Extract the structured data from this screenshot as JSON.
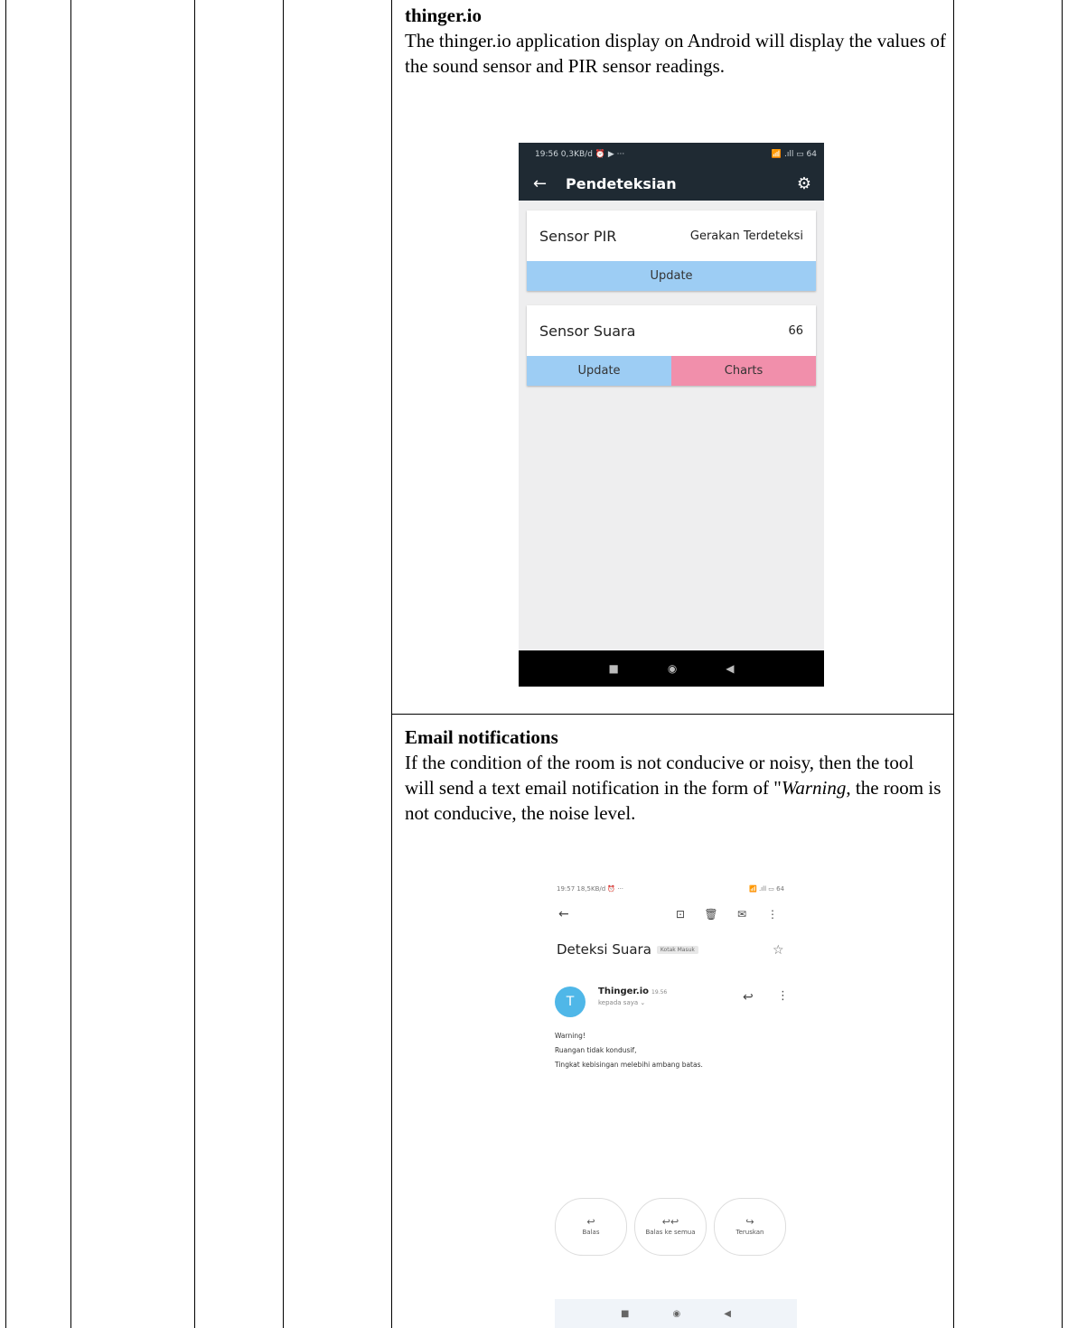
{
  "section1": {
    "heading": "thinger.io",
    "body": "The thinger.io application display on Android will display the values of the sound sensor and PIR sensor readings."
  },
  "phone1": {
    "status_left": "19:56 0,3KB/d ⏰ ▶ ···",
    "status_right": "📶 .ıll ▭ 64",
    "back_icon": "←",
    "title": "Pendeteksian",
    "gear_icon": "⚙",
    "pir_card": {
      "name": "Sensor PIR",
      "value": "Gerakan Terdeteksi",
      "update_label": "Update"
    },
    "sound_card": {
      "name": "Sensor Suara",
      "value": "66",
      "update_label": "Update",
      "charts_label": "Charts"
    },
    "nav": {
      "recent": "■",
      "home": "◉",
      "back": "◀"
    }
  },
  "section2": {
    "heading": "Email notifications",
    "body_before": "If the condition of the room is not conducive or noisy, then the tool will send a text email notification in the form of \"",
    "body_italic": "Warning",
    "body_after": ", the room is not conducive, the noise level."
  },
  "phone2": {
    "status_left": "19:57 18,5KB/d ⏰ ···",
    "status_right": "📶 .ıll ▭ 64",
    "back_icon": "←",
    "archive_icon": "⊡",
    "delete_icon": "🗑",
    "mail_icon": "✉",
    "more_icon": "⋮",
    "subject": "Deteksi Suara",
    "label": "Kotak Masuk",
    "star_icon": "☆",
    "avatar_letter": "T",
    "sender": "Thinger.io",
    "time": "19.56",
    "recipient": "kepada saya ⌄",
    "reply_icon": "↩",
    "body_lines": [
      "Warning!",
      "Ruangan tidak kondusif,",
      "Tingkat kebisingan melebihi ambang batas."
    ],
    "actions": [
      {
        "icon": "↩",
        "label": "Balas"
      },
      {
        "icon": "↩↩",
        "label": "Balas ke semua"
      },
      {
        "icon": "↪",
        "label": "Teruskan"
      }
    ],
    "nav": {
      "recent": "■",
      "home": "◉",
      "back": "◀"
    }
  }
}
